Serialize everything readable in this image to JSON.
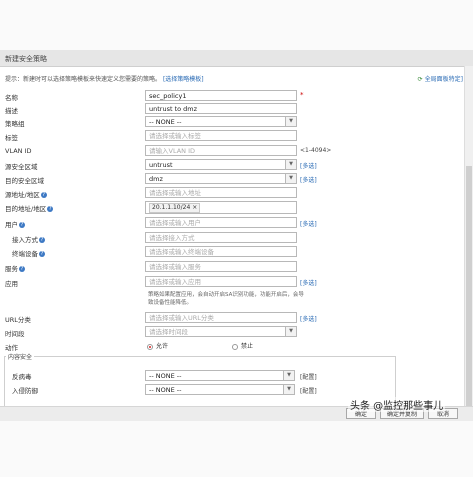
{
  "dialog": {
    "title": "新建安全策略",
    "hint_prefix": "提示：新建时可以选择策略模板来快速定义您需要的策略。",
    "hint_link": "[选择策略模板]",
    "top_right_link": "全局面板特定]"
  },
  "form": {
    "name": {
      "label": "名称",
      "value": "sec_policy1",
      "required": "*"
    },
    "desc": {
      "label": "描述",
      "value": "untrust to dmz"
    },
    "group": {
      "label": "策略组",
      "value": "-- NONE --"
    },
    "tag": {
      "label": "标签",
      "placeholder": "请选择或输入标签"
    },
    "vlan": {
      "label": "VLAN ID",
      "placeholder": "请输入VLAN ID",
      "range": "<1-4094>"
    },
    "src_zone": {
      "label": "源安全区域",
      "value": "untrust",
      "side": "[多选]"
    },
    "dst_zone": {
      "label": "目的安全区域",
      "value": "dmz",
      "side": "[多选]"
    },
    "src_addr": {
      "label": "源地址/地区",
      "placeholder": "请选择或输入地址"
    },
    "dst_addr": {
      "label": "目的地址/地区",
      "tag": "20.1.1.10/24"
    },
    "user": {
      "label": "用户",
      "placeholder": "请选择或输入用户",
      "side": "[多选]"
    },
    "access_mode": {
      "label": "接入方式",
      "placeholder": "请选择接入方式"
    },
    "terminal": {
      "label": "终端设备",
      "placeholder": "请选择或输入终端设备"
    },
    "service": {
      "label": "服务",
      "placeholder": "请选择或输入服务"
    },
    "app": {
      "label": "应用",
      "placeholder": "请选择或输入应用",
      "side": "[多选]"
    },
    "app_note": "策略如果配置应用，会自动开启SA识别功能，功能开启后，会导致设备性能降低。",
    "url": {
      "label": "URL分类",
      "placeholder": "请选择或输入URL分类",
      "side": "[多选]"
    },
    "time": {
      "label": "时间段",
      "placeholder": "请选择时间段"
    },
    "action": {
      "label": "动作",
      "permit": "允许",
      "deny": "禁止"
    }
  },
  "content_security": {
    "title": "内容安全",
    "antivirus": {
      "label": "反病毒",
      "value": "-- NONE --",
      "cfg": "[配置]"
    },
    "ips": {
      "label": "入侵防御",
      "value": "-- NONE --",
      "cfg": "[配置]"
    }
  },
  "buttons": {
    "ok": "确定",
    "ok_continue": "确定并复制",
    "cancel": "取消"
  },
  "watermark": "头条 @监控那些事儿"
}
